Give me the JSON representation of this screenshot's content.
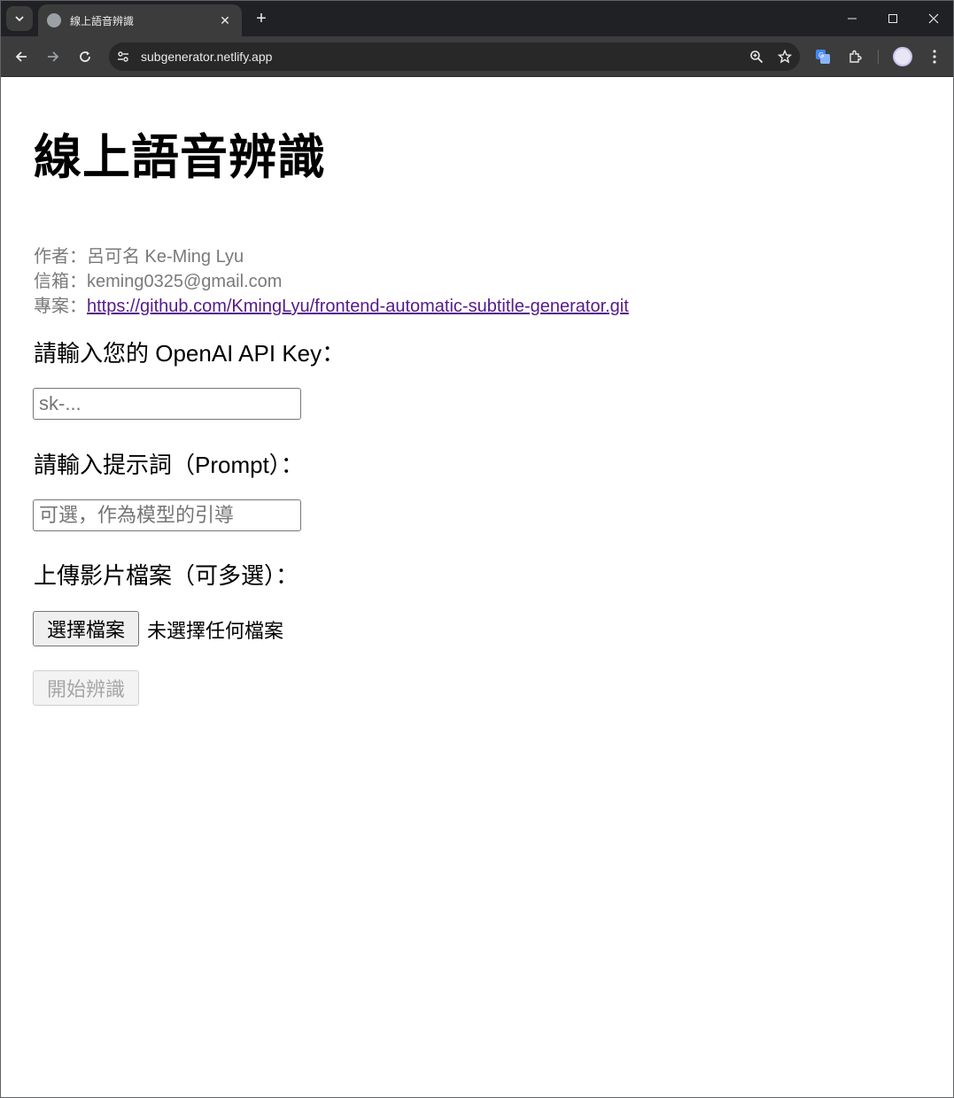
{
  "browser": {
    "tab_title": "線上語音辨識",
    "tab_close": "✕",
    "new_tab": "+",
    "url": "subgenerator.netlify.app",
    "icons": [
      "tab-search-icon",
      "favicon-icon",
      "back-icon",
      "forward-icon",
      "reload-icon",
      "site-info-icon",
      "zoom-icon",
      "star-icon",
      "translate-icon",
      "extensions-icon",
      "profile-avatar",
      "menu-icon",
      "minimize-icon",
      "maximize-icon",
      "close-icon"
    ]
  },
  "page": {
    "title": "線上語音辨識",
    "author_label": "作者：",
    "author_value": "呂可名 Ke-Ming Lyu",
    "email_label": "信箱：",
    "email_value": "keming0325@gmail.com",
    "project_label": "專案：",
    "project_link": "https://github.com/KmingLyu/frontend-automatic-subtitle-generator.git",
    "api_key_label": "請輸入您的 OpenAI API Key：",
    "api_key_placeholder": "sk-...",
    "prompt_label": "請輸入提示詞（Prompt）：",
    "prompt_placeholder": "可選，作為模型的引導",
    "upload_label": "上傳影片檔案（可多選）：",
    "choose_file_button": "選擇檔案",
    "no_file_text": "未選擇任何檔案",
    "start_button": "開始辨識"
  },
  "colors": {
    "link": "#551a8b",
    "meta_text": "#7a7a7a",
    "browser_frame": "#202124"
  }
}
